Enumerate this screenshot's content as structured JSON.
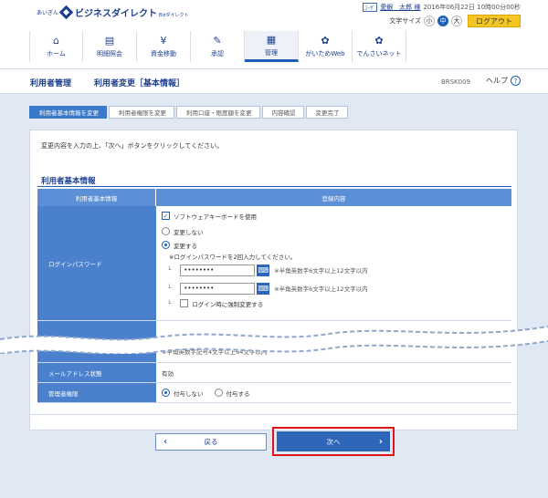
{
  "header": {
    "logo_prefix": "あいぎん",
    "logo_name": "ビジネスダイレクト",
    "logo_sub": "Bizダイレクト",
    "user_icon": "ﾕｰｻﾞ",
    "user_name": "愛銀　太郎 様",
    "last_login": "2016年06月22日 10時00分00秒",
    "font_size_label": "文字サイズ",
    "font_sizes": [
      "小",
      "中",
      "大"
    ],
    "logout_label": "ログアウト"
  },
  "gnav": [
    {
      "icon": "home-icon",
      "glyph": "⌂",
      "label": "ホーム"
    },
    {
      "icon": "statement-icon",
      "glyph": "▤",
      "label": "明細照会"
    },
    {
      "icon": "transfer-icon",
      "glyph": "¥",
      "label": "資金移動"
    },
    {
      "icon": "approval-icon",
      "glyph": "✎",
      "label": "承認"
    },
    {
      "icon": "admin-icon",
      "glyph": "▦",
      "label": "管理"
    },
    {
      "icon": "web-icon",
      "glyph": "✿",
      "label": "がいためWeb"
    },
    {
      "icon": "denzai-icon",
      "glyph": "✿",
      "label": "でんさいネット"
    }
  ],
  "titlebar": {
    "section": "利用者管理",
    "title": "利用者変更［基本情報］",
    "code": "BRSK009",
    "help_label": "ヘルプ",
    "help_icon": "?"
  },
  "steps": [
    "利用者基本情報を変更",
    "利用者権限を変更",
    "利用口座・限度額を変更",
    "内容確認",
    "変更完了"
  ],
  "main": {
    "lead": "変更内容を入力の上、「次へ」ボタンをクリックしてください。",
    "section_title": "利用者基本情報",
    "table_headers": [
      "利用者基本情報",
      "登録内容"
    ],
    "login_pw_label": "ログインパスワード",
    "software_kb_label": "ソフトウェアキーボードを使用",
    "no_change_label": "変更しない",
    "change_label": "変更する",
    "pw_twice_note": "※ログインパスワードを2回入力してください。",
    "pw_mask": "••••••••",
    "pw_hint": "※半角英数字6文字以上12文字以内",
    "force_change_label": "ログイン時に強制変更する",
    "email_hint": "※半角英数字記号4文字以上64文字以内",
    "email_status_label": "メールアドレス状態",
    "email_status_value": "有効",
    "admin_label": "管理者権限",
    "admin_no": "付与しない",
    "admin_yes": "付与する"
  },
  "buttons": {
    "back": "戻る",
    "next": "次へ",
    "back_arrow": "‹",
    "next_arrow": "›"
  }
}
